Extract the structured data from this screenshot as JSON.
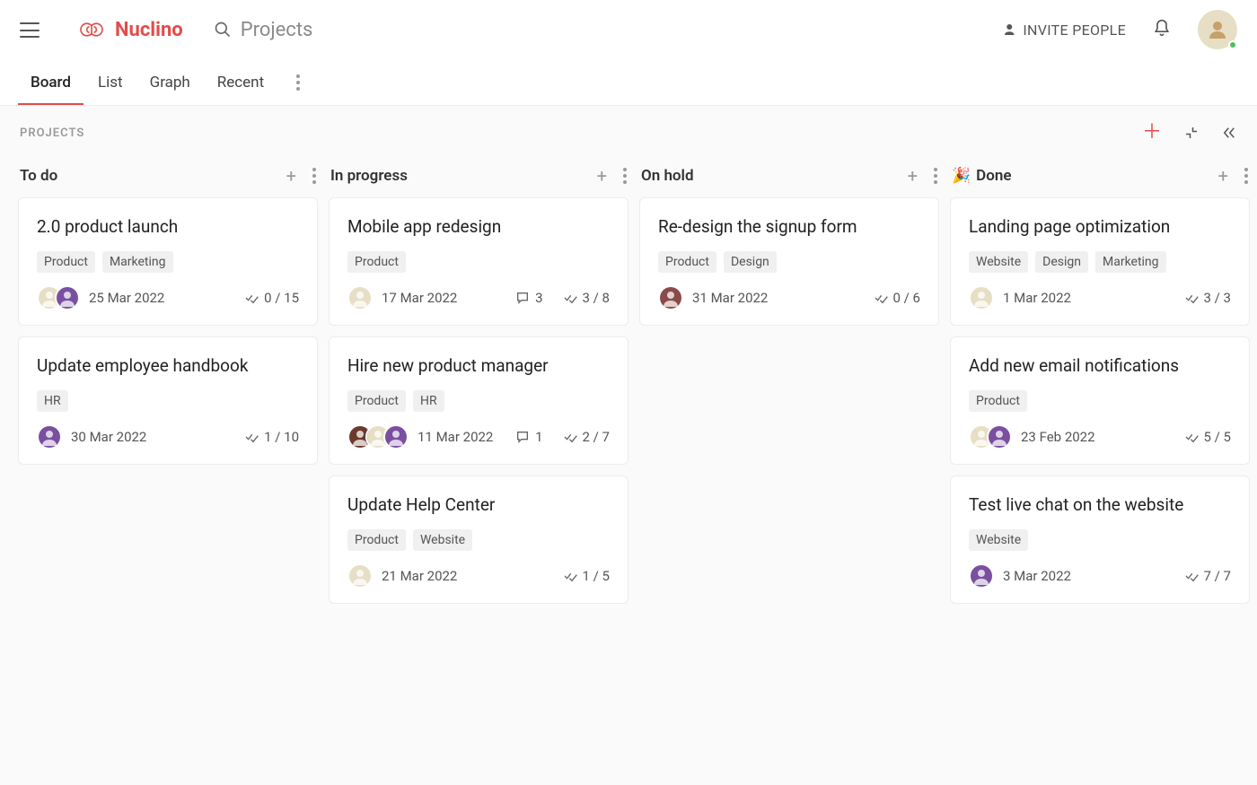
{
  "app": {
    "name": "Nuclino",
    "search_placeholder": "Projects",
    "invite_label": "INVITE PEOPLE"
  },
  "tabs": {
    "items": [
      "Board",
      "List",
      "Graph",
      "Recent"
    ],
    "active": "Board"
  },
  "subhead": {
    "label": "PROJECTS"
  },
  "columns": [
    {
      "title": "To do",
      "icon": "",
      "cards": [
        {
          "title": "2.0 product launch",
          "tags": [
            "Product",
            "Marketing"
          ],
          "avatars": [
            "#e6dfc5",
            "#7a4fa0"
          ],
          "date": "25 Mar 2022",
          "comments": null,
          "checklist": "0 / 15"
        },
        {
          "title": "Update employee handbook",
          "tags": [
            "HR"
          ],
          "avatars": [
            "#7a4fa0"
          ],
          "date": "30 Mar 2022",
          "comments": null,
          "checklist": "1 / 10"
        }
      ]
    },
    {
      "title": "In progress",
      "icon": "",
      "cards": [
        {
          "title": "Mobile app redesign",
          "tags": [
            "Product"
          ],
          "avatars": [
            "#e6dfc5"
          ],
          "date": "17 Mar 2022",
          "comments": "3",
          "checklist": "3 / 8"
        },
        {
          "title": "Hire new product manager",
          "tags": [
            "Product",
            "HR"
          ],
          "avatars": [
            "#6b3a2d",
            "#e6dfc5",
            "#7a4fa0"
          ],
          "date": "11 Mar 2022",
          "comments": "1",
          "checklist": "2 / 7"
        },
        {
          "title": "Update Help Center",
          "tags": [
            "Product",
            "Website"
          ],
          "avatars": [
            "#e6dfc5"
          ],
          "date": "21 Mar 2022",
          "comments": null,
          "checklist": "1 / 5"
        }
      ]
    },
    {
      "title": "On hold",
      "icon": "",
      "cards": [
        {
          "title": "Re-design the signup form",
          "tags": [
            "Product",
            "Design"
          ],
          "avatars": [
            "#8a4a4a"
          ],
          "date": "31 Mar 2022",
          "comments": null,
          "checklist": "0 / 6"
        }
      ]
    },
    {
      "title": "Done",
      "icon": "🎉",
      "cards": [
        {
          "title": "Landing page optimization",
          "tags": [
            "Website",
            "Design",
            "Marketing"
          ],
          "avatars": [
            "#e6dfc5"
          ],
          "date": "1 Mar 2022",
          "comments": null,
          "checklist": "3 / 3"
        },
        {
          "title": "Add new email notifications",
          "tags": [
            "Product"
          ],
          "avatars": [
            "#e6dfc5",
            "#7a4fa0"
          ],
          "date": "23 Feb 2022",
          "comments": null,
          "checklist": "5 / 5"
        },
        {
          "title": "Test live chat on the website",
          "tags": [
            "Website"
          ],
          "avatars": [
            "#7a4fa0"
          ],
          "date": "3 Mar 2022",
          "comments": null,
          "checklist": "7 / 7"
        }
      ]
    }
  ]
}
